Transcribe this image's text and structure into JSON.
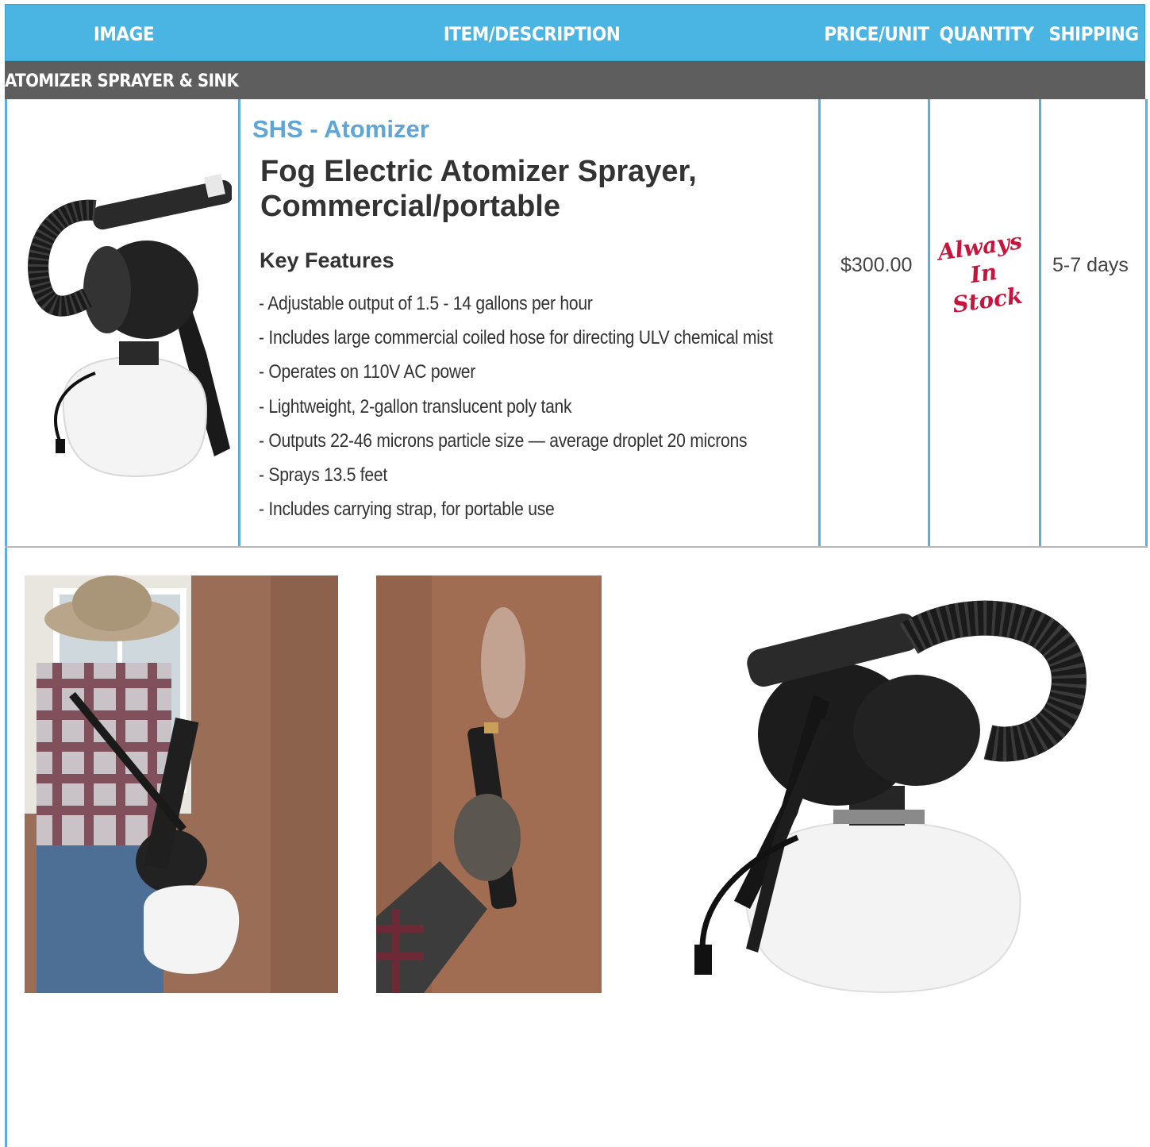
{
  "header": {
    "image": "Image",
    "item_description": "Item/Description",
    "price_unit": "Price/Unit",
    "quantity": "Quantity",
    "shipping": "Shipping"
  },
  "section": {
    "title": "Atomizer Sprayer & Sink"
  },
  "product": {
    "sku": "SHS - Atomizer",
    "title": "Fog Electric Atomizer Sprayer, Commercial/portable",
    "key_features_heading": "Key Features",
    "features": [
      "- Adjustable output of 1.5 - 14 gallons per hour",
      "- Includes large commercial coiled hose for directing ULV chemical mist",
      "- Operates on 110V AC power",
      "- Lightweight, 2-gallon translucent poly tank",
      "- Outputs 22-46 microns particle size — average droplet 20 microns",
      "- Sprays 13.5 feet",
      "- Includes carrying strap, for portable use"
    ],
    "price": "$300.00",
    "quantity": "Always In Stock",
    "shipping": "5-7 days"
  },
  "colors": {
    "header_bg": "#4ab4e2",
    "section_bg": "#5e5e5e",
    "sku_blue": "#5fa6d6",
    "stock_red": "#c8143c",
    "divider_blue": "#5aaee0"
  },
  "icons": [
    "atomizer-product-image",
    "person-spraying-photo",
    "hand-spraying-photo",
    "atomizer-large-photo"
  ]
}
